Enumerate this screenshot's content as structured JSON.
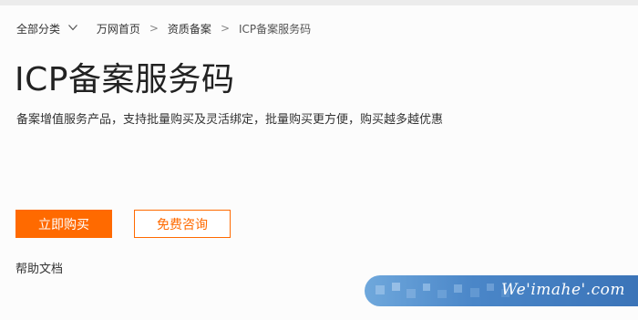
{
  "breadcrumb": {
    "all_categories": "全部分类",
    "separator": ">",
    "items": [
      "万网首页",
      "资质备案"
    ],
    "current": "ICP备案服务码"
  },
  "page": {
    "title": "ICP备案服务码",
    "subtitle": "备案增值服务产品，支持批量购买及灵活绑定，批量购买更方便，购买越多越优惠"
  },
  "actions": {
    "buy_label": "立即购买",
    "consult_label": "免费咨询"
  },
  "links": {
    "help_docs": "帮助文档"
  },
  "watermark": {
    "text": "We'imahe'.com"
  },
  "colors": {
    "accent": "#ff6a00",
    "text": "#333333",
    "background": "#fcfcfc"
  }
}
